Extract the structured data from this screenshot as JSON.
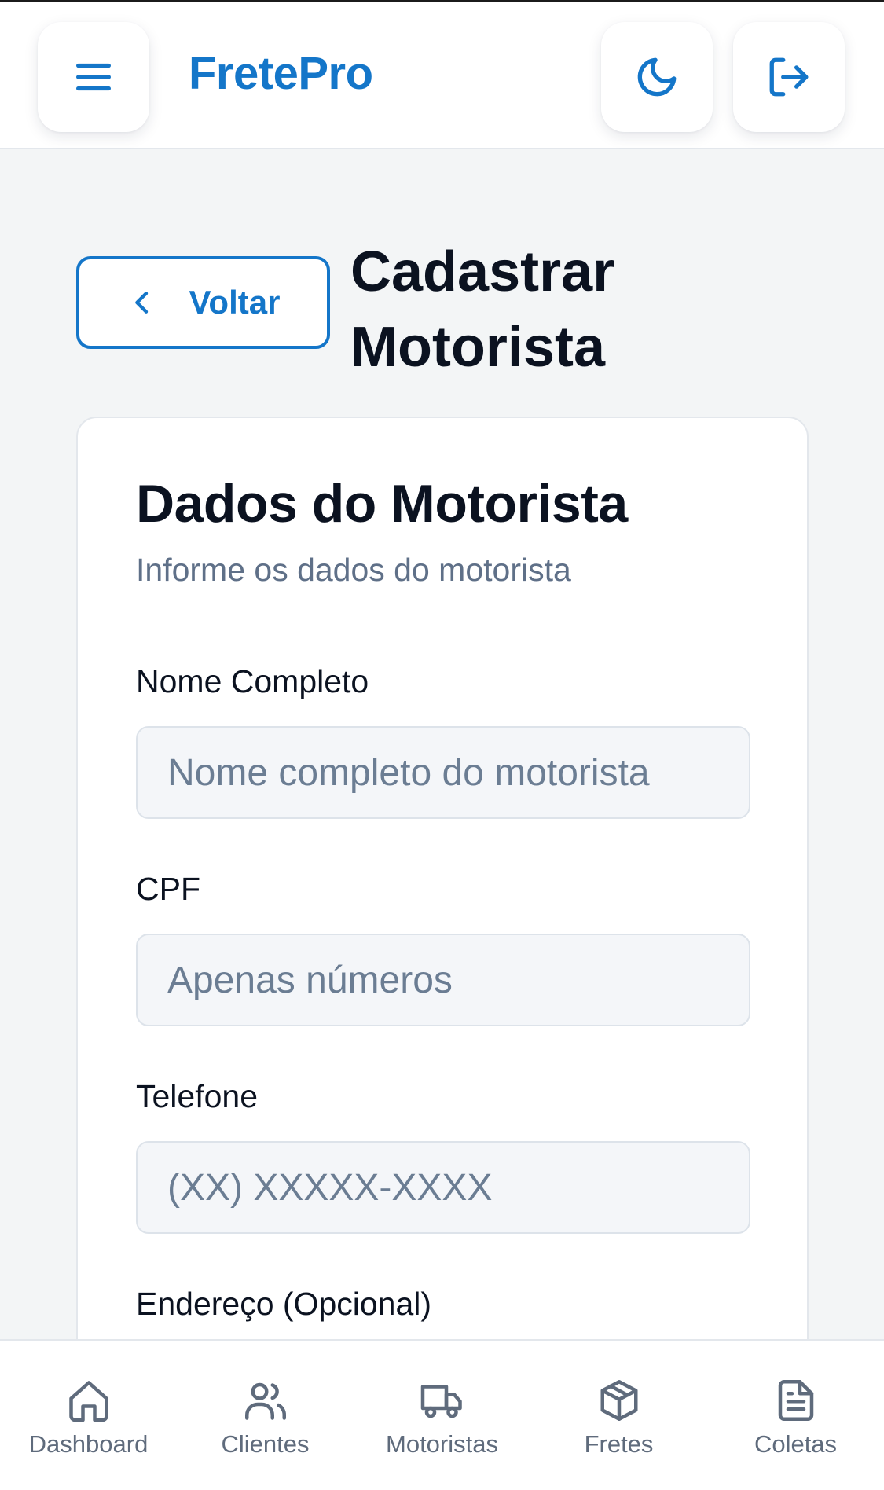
{
  "header": {
    "brand": "FretePro",
    "menu_icon": "menu-icon",
    "theme_icon": "moon-icon",
    "logout_icon": "logout-icon"
  },
  "page": {
    "back_label": "Voltar",
    "title": "Cadastrar Motorista"
  },
  "card": {
    "title": "Dados do Motorista",
    "subtitle": "Informe os dados do motorista",
    "fields": [
      {
        "label": "Nome Completo",
        "placeholder": "Nome completo do motorista",
        "value": ""
      },
      {
        "label": "CPF",
        "placeholder": "Apenas números",
        "value": ""
      },
      {
        "label": "Telefone",
        "placeholder": "(XX) XXXXX-XXXX",
        "value": ""
      },
      {
        "label": "Endereço (Opcional)"
      }
    ]
  },
  "bottom_nav": {
    "items": [
      {
        "label": "Dashboard",
        "icon": "home-icon"
      },
      {
        "label": "Clientes",
        "icon": "users-icon"
      },
      {
        "label": "Motoristas",
        "icon": "truck-icon"
      },
      {
        "label": "Fretes",
        "icon": "package-icon"
      },
      {
        "label": "Coletas",
        "icon": "document-icon"
      }
    ]
  },
  "colors": {
    "accent": "#1476c9",
    "text": "#0b1220",
    "muted": "#5f7088",
    "background": "#f3f5f6",
    "nav_text": "#5f6b7c"
  }
}
